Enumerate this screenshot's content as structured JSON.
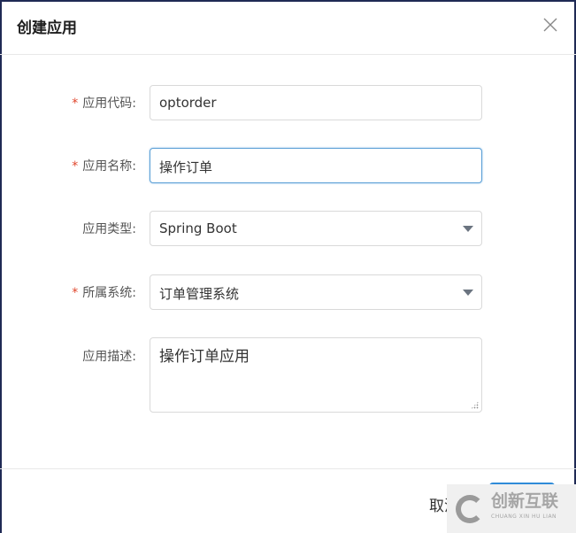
{
  "dialog": {
    "title": "创建应用",
    "close_icon": "close-icon"
  },
  "form": {
    "app_code": {
      "label": "应用代码:",
      "required": true,
      "value": "optorder"
    },
    "app_name": {
      "label": "应用名称:",
      "required": true,
      "value": "操作订单"
    },
    "app_type": {
      "label": "应用类型:",
      "required": false,
      "value": "Spring Boot"
    },
    "system": {
      "label": "所属系统:",
      "required": true,
      "value": "订单管理系统"
    },
    "description": {
      "label": "应用描述:",
      "required": false,
      "value": "操作订单应用"
    }
  },
  "required_mark": "*",
  "footer": {
    "cancel_label": "取消",
    "ok_label": ""
  },
  "watermark": {
    "text": "创新互联",
    "sub": "CHUANG XIN HU LIAN"
  },
  "colors": {
    "primary": "#2f8bd8",
    "required": "#e0452b",
    "focus_border": "#5a9fd6"
  }
}
